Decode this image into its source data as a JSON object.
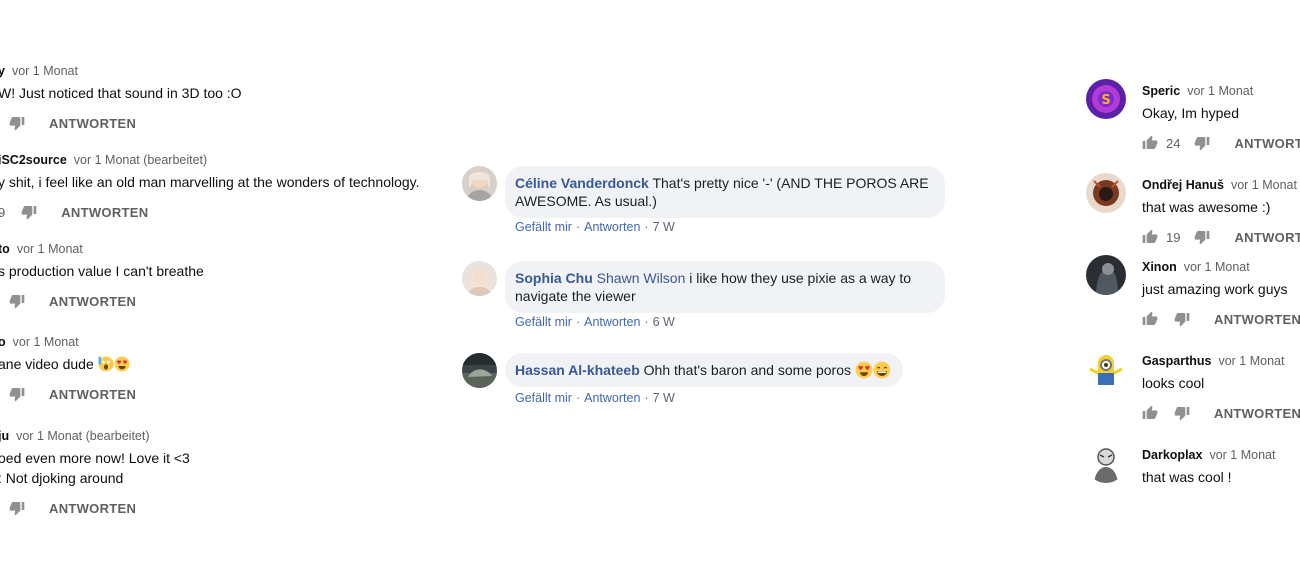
{
  "left_comments": [
    {
      "author": "y",
      "time": "vor 1 Monat",
      "lines": [
        "W! Just noticed that sound in 3D too :O"
      ],
      "likes": "",
      "reply": "ANTWORTEN"
    },
    {
      "author": "iSC2source",
      "time": "vor 1 Monat (bearbeitet)",
      "lines": [
        "y shit, i feel like an old man marvelling at the wonders of technology."
      ],
      "likes": "9",
      "reply": "ANTWORTEN"
    },
    {
      "author": "to",
      "time": "vor 1 Monat",
      "lines": [
        "s production value I can't breathe"
      ],
      "likes": "",
      "reply": "ANTWORTEN"
    },
    {
      "author": "o",
      "time": "vor 1 Monat",
      "lines": [
        "ane video dude"
      ],
      "likes": "",
      "reply": "ANTWORTEN"
    },
    {
      "author": "ju",
      "time": "vor 1 Monat (bearbeitet)",
      "lines": [
        "oed even more now! Love it <3",
        ": Not djoking around"
      ],
      "likes": "",
      "reply": "ANTWORTEN"
    }
  ],
  "fb_comments": [
    {
      "author": "Céline Vanderdonck",
      "mention": "",
      "text": "That's pretty nice '-' (AND THE POROS ARE AWESOME. As usual.)",
      "like": "Gefällt mir",
      "reply": "Antworten",
      "time": "7 W"
    },
    {
      "author": "Sophia Chu",
      "mention": "Shawn Wilson",
      "text": "i like how they use pixie as a way to navigate the viewer",
      "like": "Gefällt mir",
      "reply": "Antworten",
      "time": "6 W"
    },
    {
      "author": "Hassan Al-khateeb",
      "mention": "",
      "text": "Ohh that's baron and some poros",
      "like": "Gefällt mir",
      "reply": "Antworten",
      "time": "7 W"
    }
  ],
  "right_comments": [
    {
      "author": "Speric",
      "time": "vor 1 Monat",
      "text": "Okay, Im hyped",
      "likes": "24",
      "reply": "ANTWORTEN"
    },
    {
      "author": "Ondřej Hanuš",
      "time": "vor 1 Monat",
      "text": "that was awesome :)",
      "likes": "19",
      "reply": "ANTWORTEN"
    },
    {
      "author": "Xinon",
      "time": "vor 1 Monat",
      "text": "just amazing work guys",
      "likes": "",
      "reply": "ANTWORTEN"
    },
    {
      "author": "Gasparthus",
      "time": "vor 1 Monat",
      "text": "looks cool",
      "likes": "",
      "reply": "ANTWORTEN"
    },
    {
      "author": "Darkoplax",
      "time": "vor 1 Monat",
      "text": "that was cool !",
      "likes": "",
      "reply": "ANTWORTEN"
    }
  ],
  "icons": {
    "like": "thumb-up-icon",
    "dislike": "thumb-down-icon"
  },
  "colors": {
    "fb_link": "#385898",
    "fb_bubble": "#f0f2f5",
    "yt_meta": "#606060"
  }
}
